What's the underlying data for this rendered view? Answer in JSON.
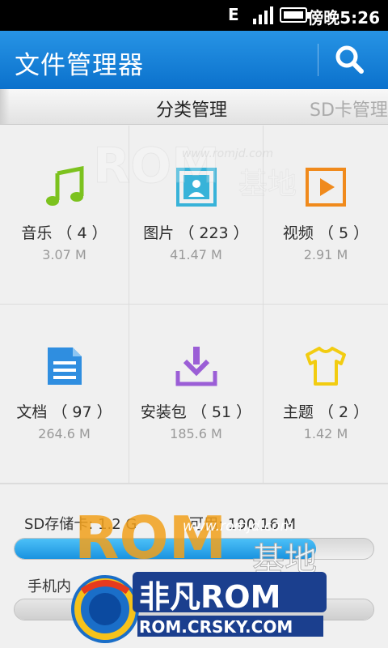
{
  "status_bar": {
    "network": "E",
    "clock": "傍晚5:26"
  },
  "header": {
    "title": "文件管理器",
    "search_icon": "search-icon"
  },
  "tabs": [
    {
      "label": "分类管理",
      "active": true
    },
    {
      "label": "SD卡管理",
      "active": false
    }
  ],
  "categories": [
    {
      "name": "音乐",
      "count": "（ 4 ）",
      "label": "音乐 （ 4 ）",
      "size": "3.07 M",
      "icon": "music-icon",
      "color": "#7cc21e"
    },
    {
      "name": "图片",
      "count": "（ 223 ）",
      "label": "图片 （ 223 ）",
      "size": "41.47 M",
      "icon": "picture-icon",
      "color": "#38b3d9"
    },
    {
      "name": "视频",
      "count": "（ 5 ）",
      "label": "视频 （ 5 ）",
      "size": "2.91 M",
      "icon": "video-icon",
      "color": "#f08a1c"
    },
    {
      "name": "文档",
      "count": "（ 97 ）",
      "label": "文档 （ 97 ）",
      "size": "264.6 M",
      "icon": "document-icon",
      "color": "#2f8ee0"
    },
    {
      "name": "安装包",
      "count": "（ 51 ）",
      "label": "安装包 （ 51 ）",
      "size": "185.6 M",
      "icon": "install-package-icon",
      "color": "#9b5ed6"
    },
    {
      "name": "主题",
      "count": "（ 2 ）",
      "label": "主题 （ 2 ）",
      "size": "1.42 M",
      "icon": "theme-shirt-icon",
      "color": "#f2cc10"
    }
  ],
  "storage": {
    "sd": {
      "label": "SD存储卡: 1.2 G",
      "available": "可用: 190.16 M",
      "fill_fraction": 0.84
    },
    "phone": {
      "label": "手机内"
    }
  },
  "watermarks": {
    "romjd_url": "www.romjd.com",
    "rom_text": "ROM",
    "jidi_text": "基地",
    "feifan_text": "非凡ROM",
    "crsky_url": "ROM.CRSKY.COM"
  }
}
